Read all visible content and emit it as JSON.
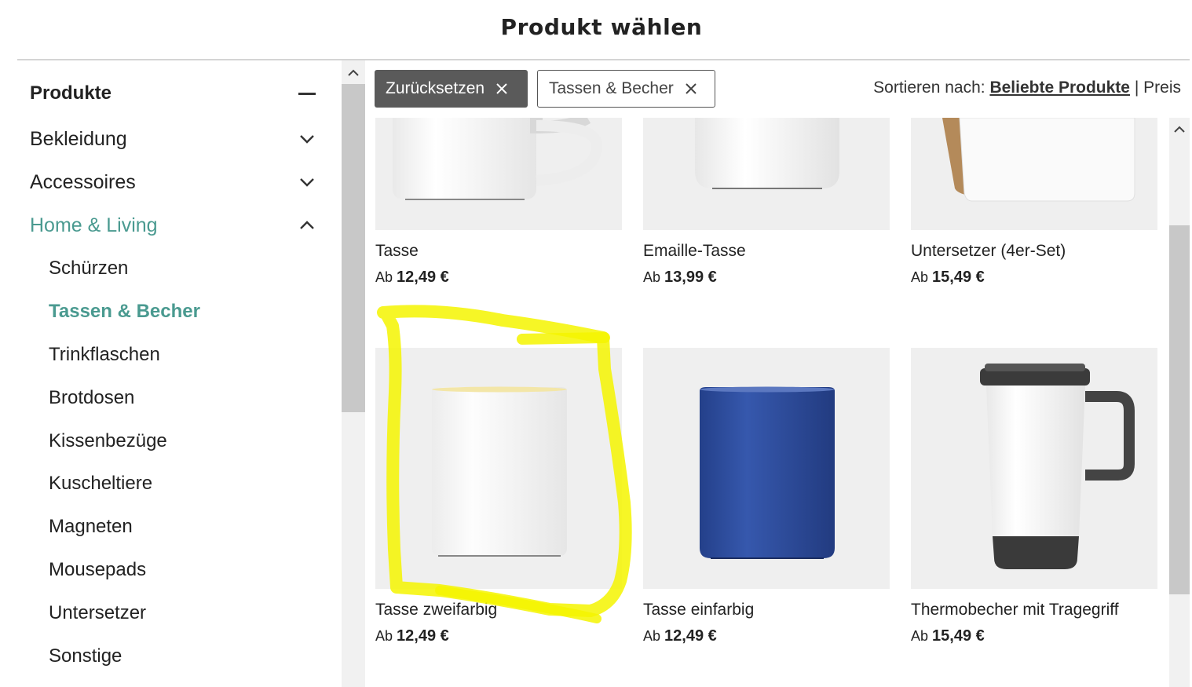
{
  "header": {
    "title": "Produkt wählen"
  },
  "sidebar": {
    "heading": "Produkte",
    "categories": [
      {
        "label": "Bekleidung"
      },
      {
        "label": "Accessoires"
      },
      {
        "label": "Home & Living"
      }
    ],
    "subitems": [
      {
        "label": "Schürzen"
      },
      {
        "label": "Tassen & Becher"
      },
      {
        "label": "Trinkflaschen"
      },
      {
        "label": "Brotdosen"
      },
      {
        "label": "Kissenbezüge"
      },
      {
        "label": "Kuscheltiere"
      },
      {
        "label": "Magneten"
      },
      {
        "label": "Mousepads"
      },
      {
        "label": "Untersetzer"
      },
      {
        "label": "Sonstige"
      }
    ]
  },
  "filters": {
    "reset_label": "Zurücksetzen",
    "active_tag": "Tassen & Becher"
  },
  "sort": {
    "prefix": "Sortieren nach:",
    "selected": "Beliebte Produkte",
    "separator": "|",
    "alternative": "Preis"
  },
  "products": [
    {
      "name": "Tasse",
      "price_prefix": "Ab",
      "price": "12,49 €"
    },
    {
      "name": "Emaille-Tasse",
      "price_prefix": "Ab",
      "price": "13,99 €"
    },
    {
      "name": "Untersetzer (4er-Set)",
      "price_prefix": "Ab",
      "price": "15,49 €"
    },
    {
      "name": "Tasse zweifarbig",
      "price_prefix": "Ab",
      "price": "12,49 €"
    },
    {
      "name": "Tasse einfarbig",
      "price_prefix": "Ab",
      "price": "12,49 €"
    },
    {
      "name": "Thermobecher mit Tragegriff",
      "price_prefix": "Ab",
      "price": "15,49 €"
    }
  ],
  "colors": {
    "accent": "#4a9a90",
    "highlight": "#f5f500",
    "mug_blue": "#2f4f9e"
  }
}
